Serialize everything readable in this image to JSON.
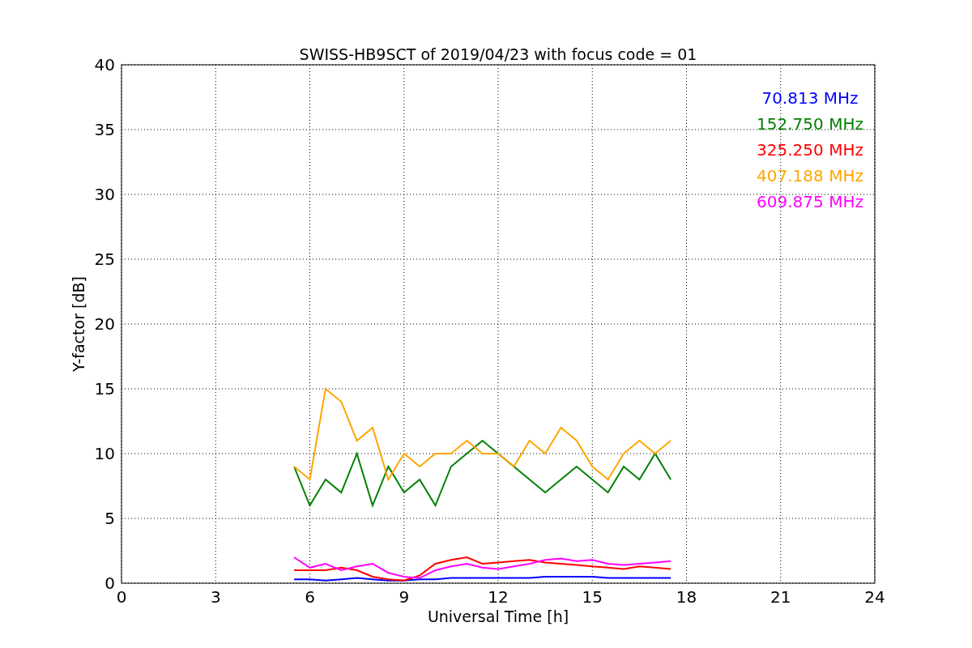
{
  "chart_data": {
    "type": "line",
    "title": "SWISS-HB9SCT of 2019/04/23 with focus code = 01",
    "xlabel": "Universal Time [h]",
    "ylabel": "Y-factor [dB]",
    "xlim": [
      0,
      24
    ],
    "ylim": [
      0,
      40
    ],
    "grid": true,
    "xticks": [
      0,
      3,
      6,
      9,
      12,
      15,
      18,
      21,
      24
    ],
    "yticks": [
      0,
      5,
      10,
      15,
      20,
      25,
      30,
      35,
      40
    ],
    "x": [
      5.5,
      6,
      6.5,
      7,
      7.5,
      8,
      8.5,
      9,
      9.5,
      10,
      10.5,
      11,
      11.5,
      12,
      12.5,
      13,
      13.5,
      14,
      14.5,
      15,
      15.5,
      16,
      16.5,
      17,
      17.5
    ],
    "series": [
      {
        "name": "70.813 MHz",
        "color": "#0000ff",
        "values": [
          0.3,
          0.3,
          0.2,
          0.3,
          0.4,
          0.3,
          0.2,
          0.2,
          0.3,
          0.3,
          0.4,
          0.4,
          0.4,
          0.4,
          0.4,
          0.4,
          0.5,
          0.5,
          0.5,
          0.5,
          0.4,
          0.4,
          0.4,
          0.4,
          0.4
        ]
      },
      {
        "name": "152.750 MHz",
        "color": "#008000",
        "values": [
          9,
          6,
          8,
          7,
          10,
          6,
          9,
          7,
          8,
          6,
          9,
          10,
          11,
          10,
          9,
          8,
          7,
          8,
          9,
          8,
          7,
          9,
          8,
          10,
          8
        ]
      },
      {
        "name": "325.250 MHz",
        "color": "#ff0000",
        "values": [
          1,
          1,
          1,
          1.2,
          1,
          0.5,
          0.3,
          0.2,
          0.6,
          1.5,
          1.8,
          2,
          1.5,
          1.6,
          1.7,
          1.8,
          1.6,
          1.5,
          1.4,
          1.3,
          1.2,
          1.1,
          1.3,
          1.2,
          1.1
        ]
      },
      {
        "name": "407.188 MHz",
        "color": "#ffa500",
        "values": [
          9,
          8,
          15,
          14,
          11,
          12,
          8,
          10,
          9,
          10,
          10,
          11,
          10,
          10,
          9,
          11,
          10,
          12,
          11,
          9,
          8,
          10,
          11,
          10,
          11
        ]
      },
      {
        "name": "609.875 MHz",
        "color": "#ff00ff",
        "values": [
          2,
          1.2,
          1.5,
          1,
          1.3,
          1.5,
          0.8,
          0.5,
          0.4,
          1,
          1.3,
          1.5,
          1.2,
          1.1,
          1.3,
          1.5,
          1.8,
          1.9,
          1.7,
          1.8,
          1.5,
          1.4,
          1.5,
          1.6,
          1.7
        ]
      }
    ]
  }
}
